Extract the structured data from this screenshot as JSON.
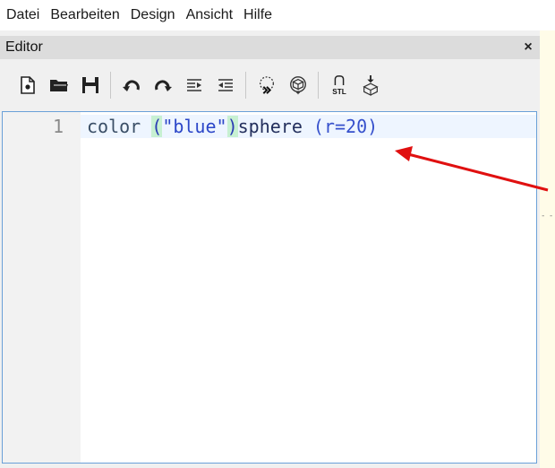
{
  "menubar": {
    "items": [
      "Datei",
      "Bearbeiten",
      "Design",
      "Ansicht",
      "Hilfe"
    ]
  },
  "panel": {
    "title": "Editor",
    "close_glyph": "×"
  },
  "toolbar": {
    "buttons": [
      {
        "icon": "new-file-icon"
      },
      {
        "icon": "open-folder-icon"
      },
      {
        "icon": "save-icon"
      },
      {
        "icon": "undo-icon"
      },
      {
        "icon": "redo-icon"
      },
      {
        "icon": "indent-icon"
      },
      {
        "icon": "unindent-icon"
      },
      {
        "icon": "preview-icon"
      },
      {
        "icon": "render-icon"
      },
      {
        "icon": "export-stl-icon",
        "label": "STL"
      },
      {
        "icon": "print-3d-icon"
      }
    ]
  },
  "editor": {
    "line_number": "1",
    "tokens": {
      "keyword": "color",
      "space1": " ",
      "open_paren": "(",
      "string": "\"blue\"",
      "close_paren": ")",
      "ident": "sphere",
      "space2": " ",
      "arg": "(r=20)"
    }
  },
  "annotation": {
    "color": "#e01010"
  },
  "colors": {
    "accent_border": "#6aa0d8",
    "paren_match": "#c7f0d2",
    "right_strip": "#fffce8"
  }
}
